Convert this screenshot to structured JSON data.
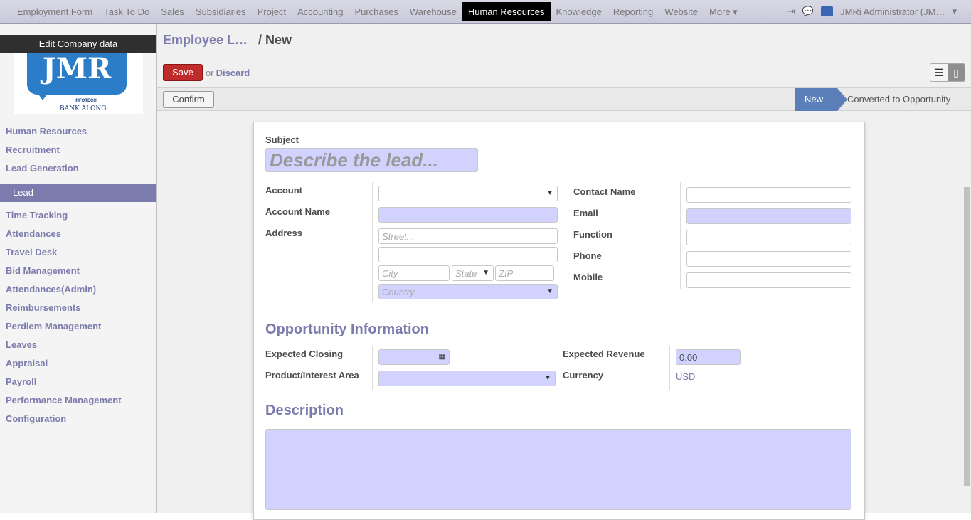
{
  "topbar": {
    "menu": [
      "Employment Form",
      "Task To Do",
      "Sales",
      "Subsidiaries",
      "Project",
      "Accounting",
      "Purchases",
      "Warehouse",
      "Human Resources",
      "Knowledge",
      "Reporting",
      "Website",
      "More ▾"
    ],
    "active_index": 8,
    "user": "JMRi Administrator (JM…"
  },
  "sidebar": {
    "edit_company": "Edit Company data",
    "logo": {
      "text": "JMR",
      "tagline1": "INFOTECH",
      "tagline2": "BANK ALONG"
    },
    "items": [
      "Human Resources",
      "Recruitment",
      "Lead Generation",
      "Lead",
      "Time Tracking",
      "Attendances",
      "Travel Desk",
      "Bid Management",
      "Attendances(Admin)",
      "Reimbursements",
      "Perdiem Management",
      "Leaves",
      "Appraisal",
      "Payroll",
      "Performance Management",
      "Configuration"
    ],
    "active_item": "Lead"
  },
  "header": {
    "breadcrumb_parent": "Employee L…",
    "breadcrumb_current": "/ New"
  },
  "actions": {
    "save": "Save",
    "or": "or",
    "discard": "Discard"
  },
  "status": {
    "confirm": "Confirm",
    "stages": [
      "New",
      "Converted to Opportunity"
    ],
    "current_stage": "New"
  },
  "form": {
    "subject_label": "Subject",
    "subject_placeholder": "Describe the lead...",
    "account_label": "Account",
    "account_name_label": "Account Name",
    "address_label": "Address",
    "street_placeholder": "Street...",
    "city_placeholder": "City",
    "state_placeholder": "State",
    "zip_placeholder": "ZIP",
    "country_placeholder": "Country",
    "contact_name_label": "Contact Name",
    "email_label": "Email",
    "function_label": "Function",
    "phone_label": "Phone",
    "mobile_label": "Mobile",
    "opportunity_heading": "Opportunity Information",
    "expected_closing_label": "Expected Closing",
    "product_label": "Product/Interest Area",
    "expected_revenue_label": "Expected Revenue",
    "expected_revenue_value": "0.00",
    "currency_label": "Currency",
    "currency_value": "USD",
    "description_heading": "Description"
  }
}
